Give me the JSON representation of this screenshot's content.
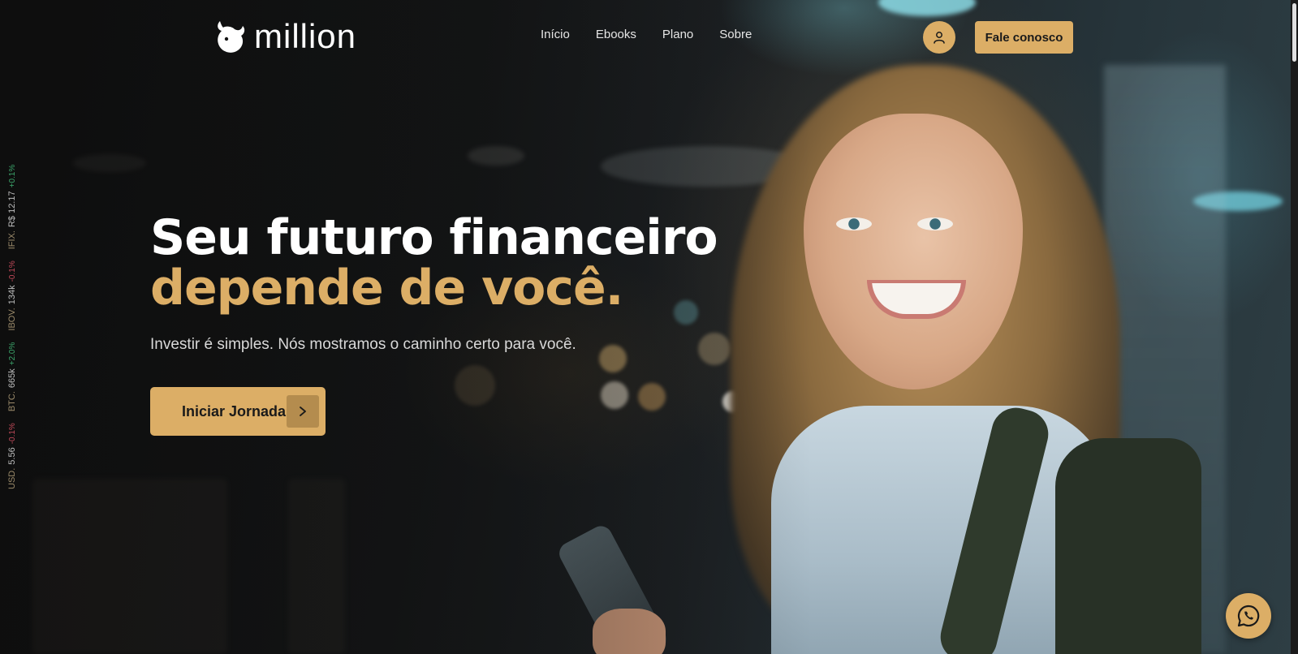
{
  "brand": {
    "name": "million",
    "accent_color": "#dcae66",
    "logo_icon": "bull-icon"
  },
  "nav": {
    "items": [
      {
        "label": "Início"
      },
      {
        "label": "Ebooks"
      },
      {
        "label": "Plano"
      },
      {
        "label": "Sobre"
      }
    ]
  },
  "header": {
    "user_icon": "user-icon",
    "contact_label": "Fale conosco"
  },
  "ticker": {
    "items": [
      {
        "name": "USD.",
        "value": "5.56",
        "change": "-0.1%",
        "direction": "down"
      },
      {
        "name": "BTC.",
        "value": "665k",
        "change": "+2.0%",
        "direction": "up"
      },
      {
        "name": "IBOV.",
        "value": "134k",
        "change": "-0.1%",
        "direction": "down"
      },
      {
        "name": "IFIX.",
        "value": "R$ 12.17",
        "change": "+0.1%",
        "direction": "up"
      }
    ]
  },
  "hero": {
    "title_line1": "Seu futuro financeiro",
    "title_line2": "depende de você.",
    "subtitle": "Investir é simples. Nós mostramos o caminho certo para você.",
    "cta_label": "Iniciar Jornada",
    "cta_icon": "chevron-right-icon"
  },
  "floating": {
    "whatsapp_icon": "whatsapp-icon"
  }
}
